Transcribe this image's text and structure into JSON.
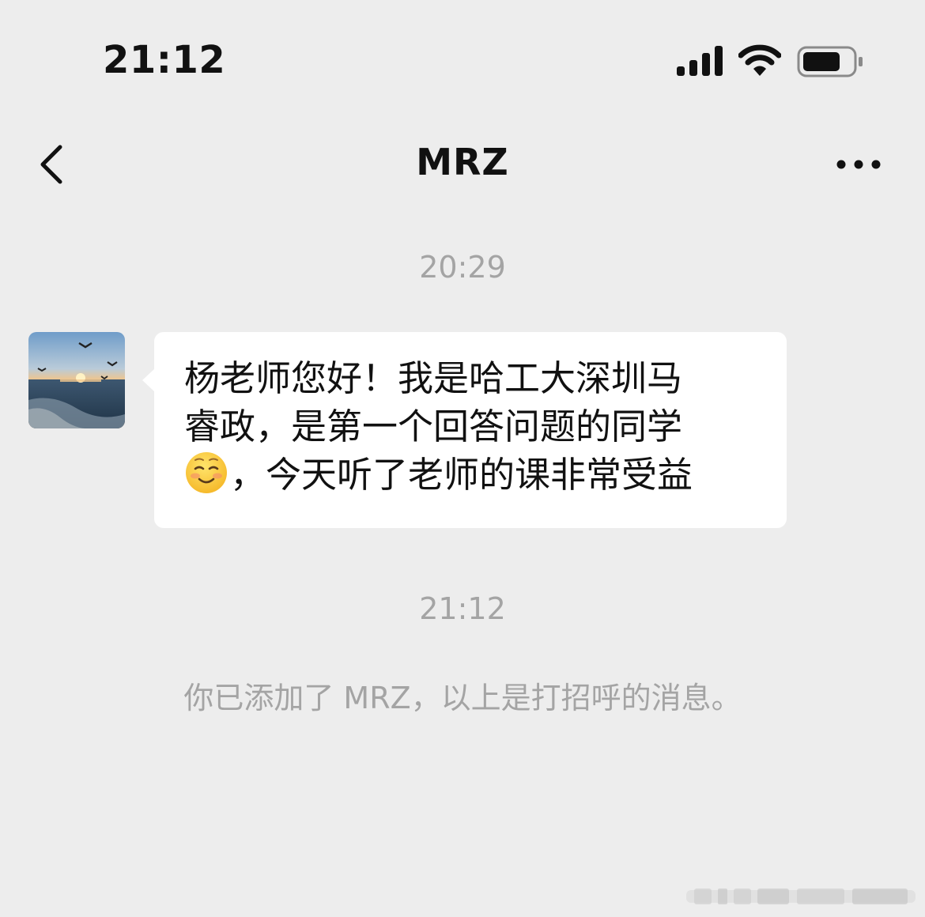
{
  "status_bar": {
    "time": "21:12"
  },
  "nav": {
    "title": "MRZ"
  },
  "chat": {
    "timestamp_1": "20:29",
    "message_lines": [
      "杨老师您好！我是哈工大深圳马",
      "睿政，是第一个回答问题的同学",
      "，今天听了老师的课非常受益"
    ],
    "message_emoji": "smiling-face-emoji",
    "timestamp_2": "21:12",
    "system_message": "你已添加了 MRZ，以上是打招呼的消息。"
  },
  "colors": {
    "background": "#ededed",
    "bubble": "#ffffff",
    "meta_text": "#a4a4a4",
    "primary_text": "#111111"
  },
  "icons": {
    "back": "chevron-left-icon",
    "more": "more-dots-icon",
    "signal": "cellular-signal-icon",
    "wifi": "wifi-icon",
    "battery": "battery-icon"
  }
}
